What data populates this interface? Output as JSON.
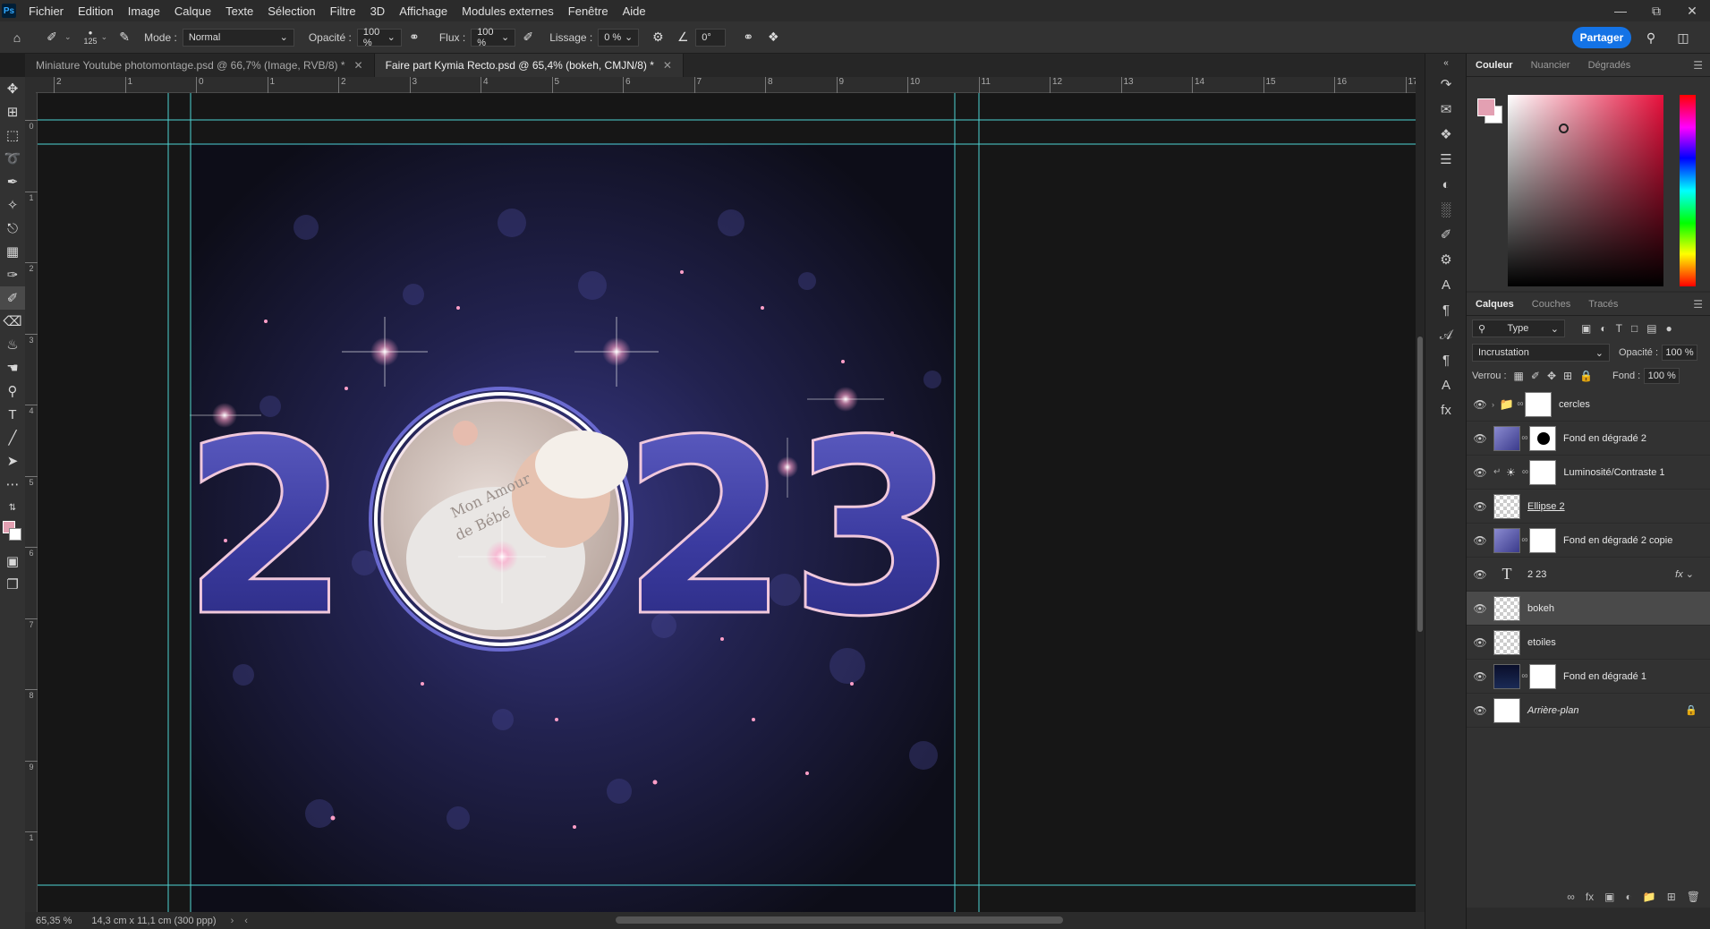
{
  "menu": {
    "logo": "Ps",
    "items": [
      "Fichier",
      "Edition",
      "Image",
      "Calque",
      "Texte",
      "Sélection",
      "Filtre",
      "3D",
      "Affichage",
      "Modules externes",
      "Fenêtre",
      "Aide"
    ]
  },
  "options": {
    "brush_size": "125",
    "mode_label": "Mode :",
    "mode_value": "Normal",
    "opacity_label": "Opacité :",
    "opacity_value": "100 %",
    "flow_label": "Flux :",
    "flow_value": "100 %",
    "smoothing_label": "Lissage :",
    "smoothing_value": "0 %",
    "angle_value": "0°",
    "share_label": "Partager"
  },
  "tabs": [
    {
      "label": "Miniature Youtube photomontage.psd @ 66,7% (Image, RVB/8) *",
      "active": false
    },
    {
      "label": "Faire part Kymia Recto.psd @ 65,4% (bokeh, CMJN/8) *",
      "active": true
    }
  ],
  "ruler": {
    "top": [
      "2",
      "1",
      "0",
      "1",
      "2",
      "3",
      "4",
      "5",
      "6",
      "7",
      "8",
      "9",
      "10",
      "11",
      "12",
      "13",
      "14",
      "15",
      "16",
      "17"
    ],
    "left": [
      "0",
      "1",
      "2",
      "3",
      "4",
      "5",
      "6",
      "7",
      "8",
      "9",
      "1"
    ]
  },
  "artwork": {
    "digits_left": "2",
    "digits_right": "23",
    "photo_caption_1": "Mon Amour",
    "photo_caption_2": "de Bébé"
  },
  "status": {
    "zoom": "65,35 %",
    "doc_info": "14,3 cm x 11,1 cm (300 ppp)"
  },
  "color_panel": {
    "tabs": [
      "Couleur",
      "Nuancier",
      "Dégradés"
    ],
    "fg_color": "#e3a0b2",
    "bg_color": "#ffffff"
  },
  "layers_panel": {
    "tabs": [
      "Calques",
      "Couches",
      "Tracés"
    ],
    "filter_label": "Type",
    "blend_mode": "Incrustation",
    "opacity_label": "Opacité :",
    "opacity_value": "100 %",
    "lock_label": "Verrou :",
    "fill_label": "Fond :",
    "fill_value": "100 %",
    "layers": [
      {
        "name": "cercles",
        "kind": "group"
      },
      {
        "name": "Fond en dégradé 2",
        "kind": "gradient-mask-ellipse"
      },
      {
        "name": "Luminosité/Contraste 1",
        "kind": "adjustment"
      },
      {
        "name": "Ellipse 2",
        "kind": "pixel"
      },
      {
        "name": "Fond en dégradé 2 copie",
        "kind": "gradient-mask"
      },
      {
        "name": "2    23",
        "kind": "text"
      },
      {
        "name": "bokeh",
        "kind": "pixel",
        "selected": true
      },
      {
        "name": "etoiles",
        "kind": "pixel"
      },
      {
        "name": "Fond en dégradé 1",
        "kind": "dark-mask"
      },
      {
        "name": "Arrière-plan",
        "kind": "background"
      }
    ]
  }
}
